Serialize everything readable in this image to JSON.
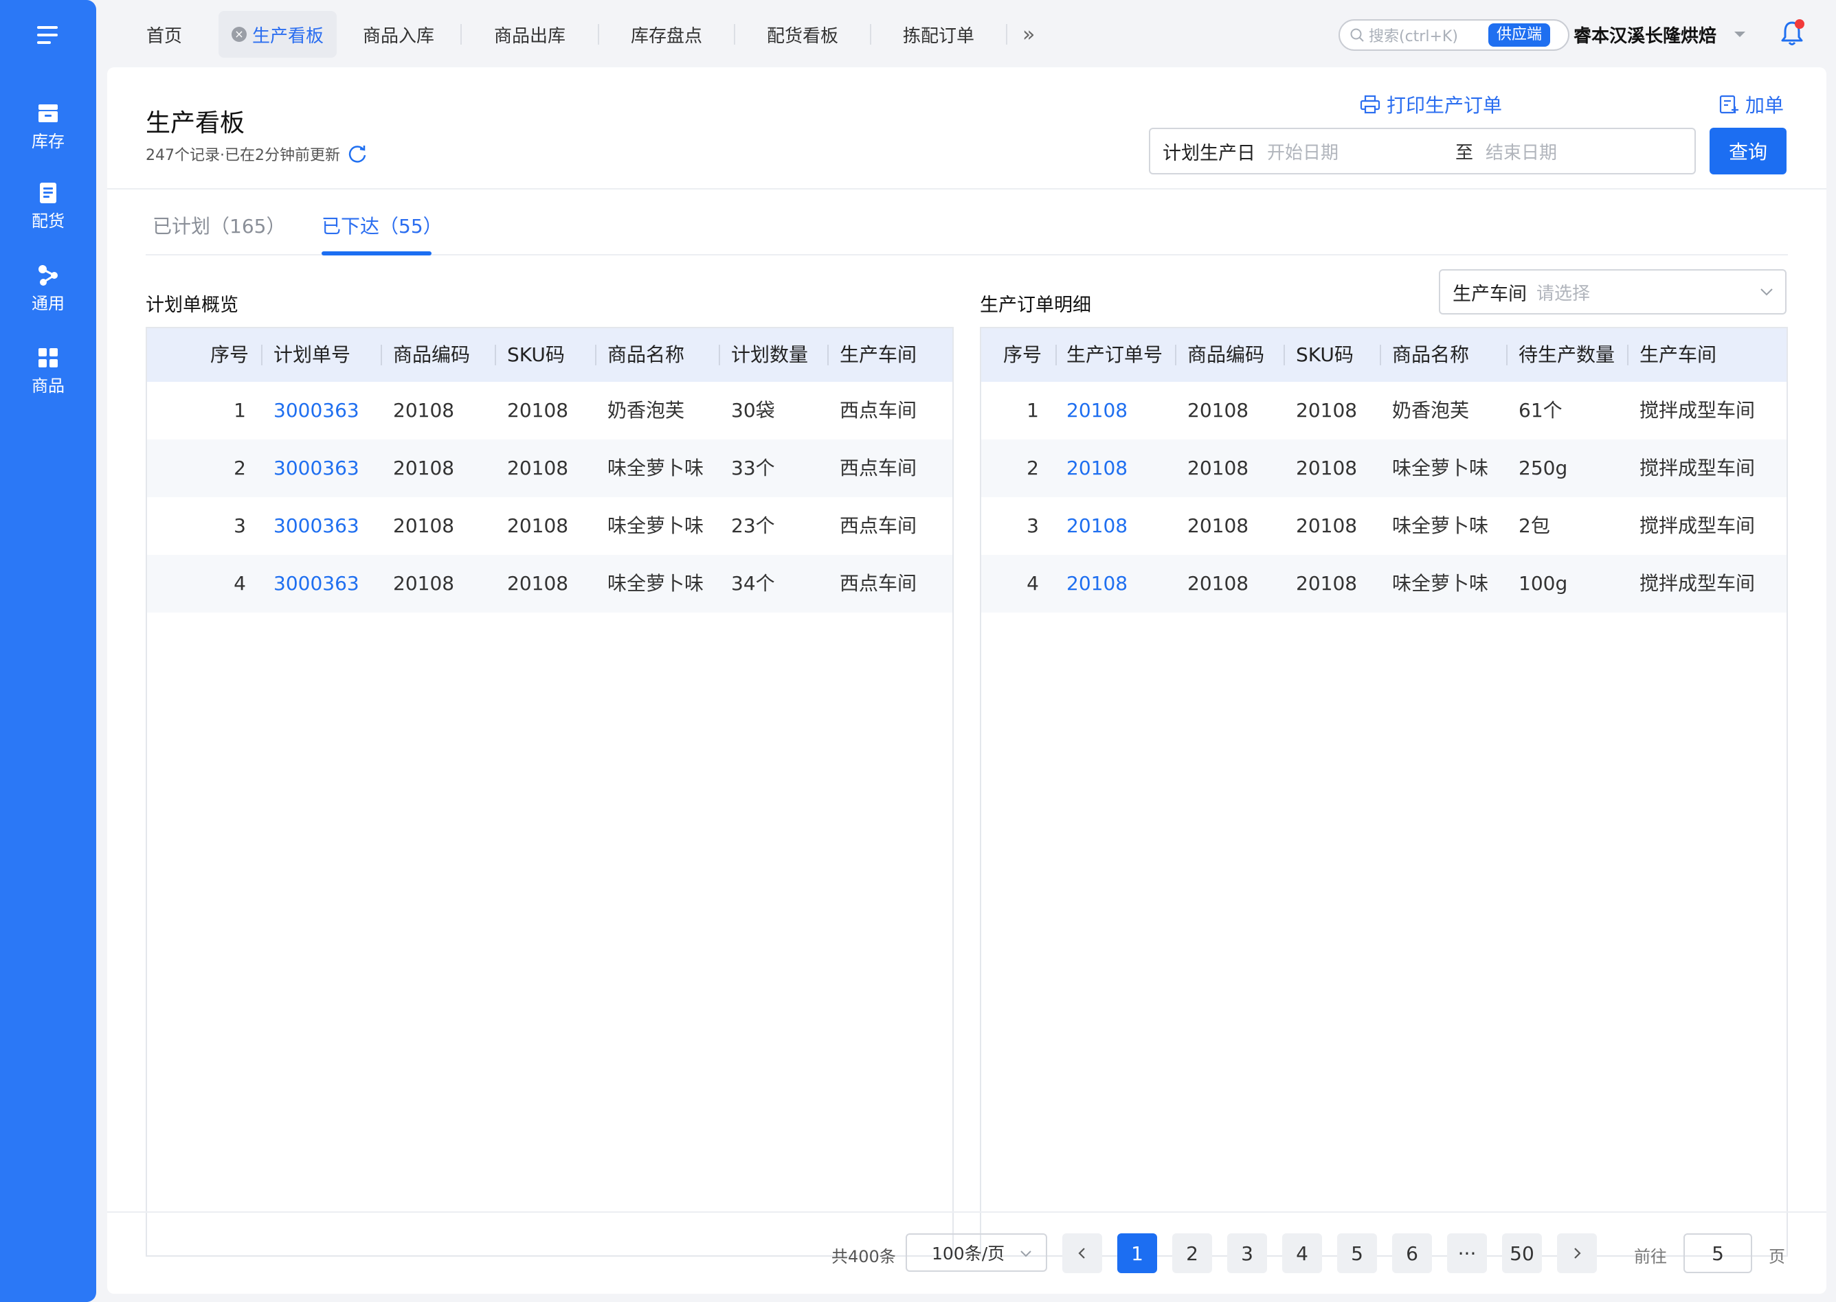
{
  "sidebar": {
    "items": [
      {
        "label": "库存",
        "icon": "inventory-icon"
      },
      {
        "label": "配货",
        "icon": "distribution-icon"
      },
      {
        "label": "通用",
        "icon": "share-icon"
      },
      {
        "label": "商品",
        "icon": "grid-icon"
      }
    ]
  },
  "topbar": {
    "tabs": [
      "首页",
      "生产看板",
      "商品入库",
      "商品出库",
      "库存盘点",
      "配货看板",
      "拣配订单"
    ],
    "active_tab": "生产看板",
    "search_placeholder": "搜索(ctrl+K)",
    "role_badge": "供应端",
    "org_name": "睿本汉溪长隆烘焙"
  },
  "page": {
    "title": "生产看板",
    "subtitle": "247个记录·已在2分钟前更新",
    "print_label": "打印生产订单",
    "add_label": "加单",
    "date_filter": {
      "label": "计划生产日",
      "start_placeholder": "开始日期",
      "separator": "至",
      "end_placeholder": "结束日期"
    },
    "query_label": "查询",
    "status_tabs": [
      {
        "label": "已计划（165）",
        "active": false
      },
      {
        "label": "已下达（55）",
        "active": true
      }
    ]
  },
  "plan_table": {
    "title": "计划单概览",
    "columns": [
      "序号",
      "计划单号",
      "商品编码",
      "SKU码",
      "商品名称",
      "计划数量",
      "生产车间"
    ],
    "rows": [
      [
        "1",
        "3000363",
        "20108",
        "20108",
        "奶香泡芙",
        "30袋",
        "西点车间"
      ],
      [
        "2",
        "3000363",
        "20108",
        "20108",
        "味全萝卜味",
        "33个",
        "西点车间"
      ],
      [
        "3",
        "3000363",
        "20108",
        "20108",
        "味全萝卜味",
        "23个",
        "西点车间"
      ],
      [
        "4",
        "3000363",
        "20108",
        "20108",
        "味全萝卜味",
        "34个",
        "西点车间"
      ]
    ]
  },
  "order_table": {
    "title": "生产订单明细",
    "workshop_filter": {
      "label": "生产车间",
      "placeholder": "请选择"
    },
    "columns": [
      "序号",
      "生产订单号",
      "商品编码",
      "SKU码",
      "商品名称",
      "待生产数量",
      "生产车间"
    ],
    "rows": [
      [
        "1",
        "20108",
        "20108",
        "20108",
        "奶香泡芙",
        "61个",
        "搅拌成型车间"
      ],
      [
        "2",
        "20108",
        "20108",
        "20108",
        "味全萝卜味",
        "250g",
        "搅拌成型车间"
      ],
      [
        "3",
        "20108",
        "20108",
        "20108",
        "味全萝卜味",
        "2包",
        "搅拌成型车间"
      ],
      [
        "4",
        "20108",
        "20108",
        "20108",
        "味全萝卜味",
        "100g",
        "搅拌成型车间"
      ]
    ]
  },
  "pagination": {
    "total": "共400条",
    "page_size": "100条/页",
    "pages": [
      "1",
      "2",
      "3",
      "4",
      "5",
      "6",
      "···",
      "50"
    ],
    "current": "1",
    "goto_label": "前往",
    "goto_value": "5",
    "page_suffix": "页"
  },
  "colors": {
    "primary": "#1c6ef2",
    "sidebar": "#2b78f6",
    "table_header": "#e8eefb",
    "notification_dot": "#f23a3a"
  }
}
